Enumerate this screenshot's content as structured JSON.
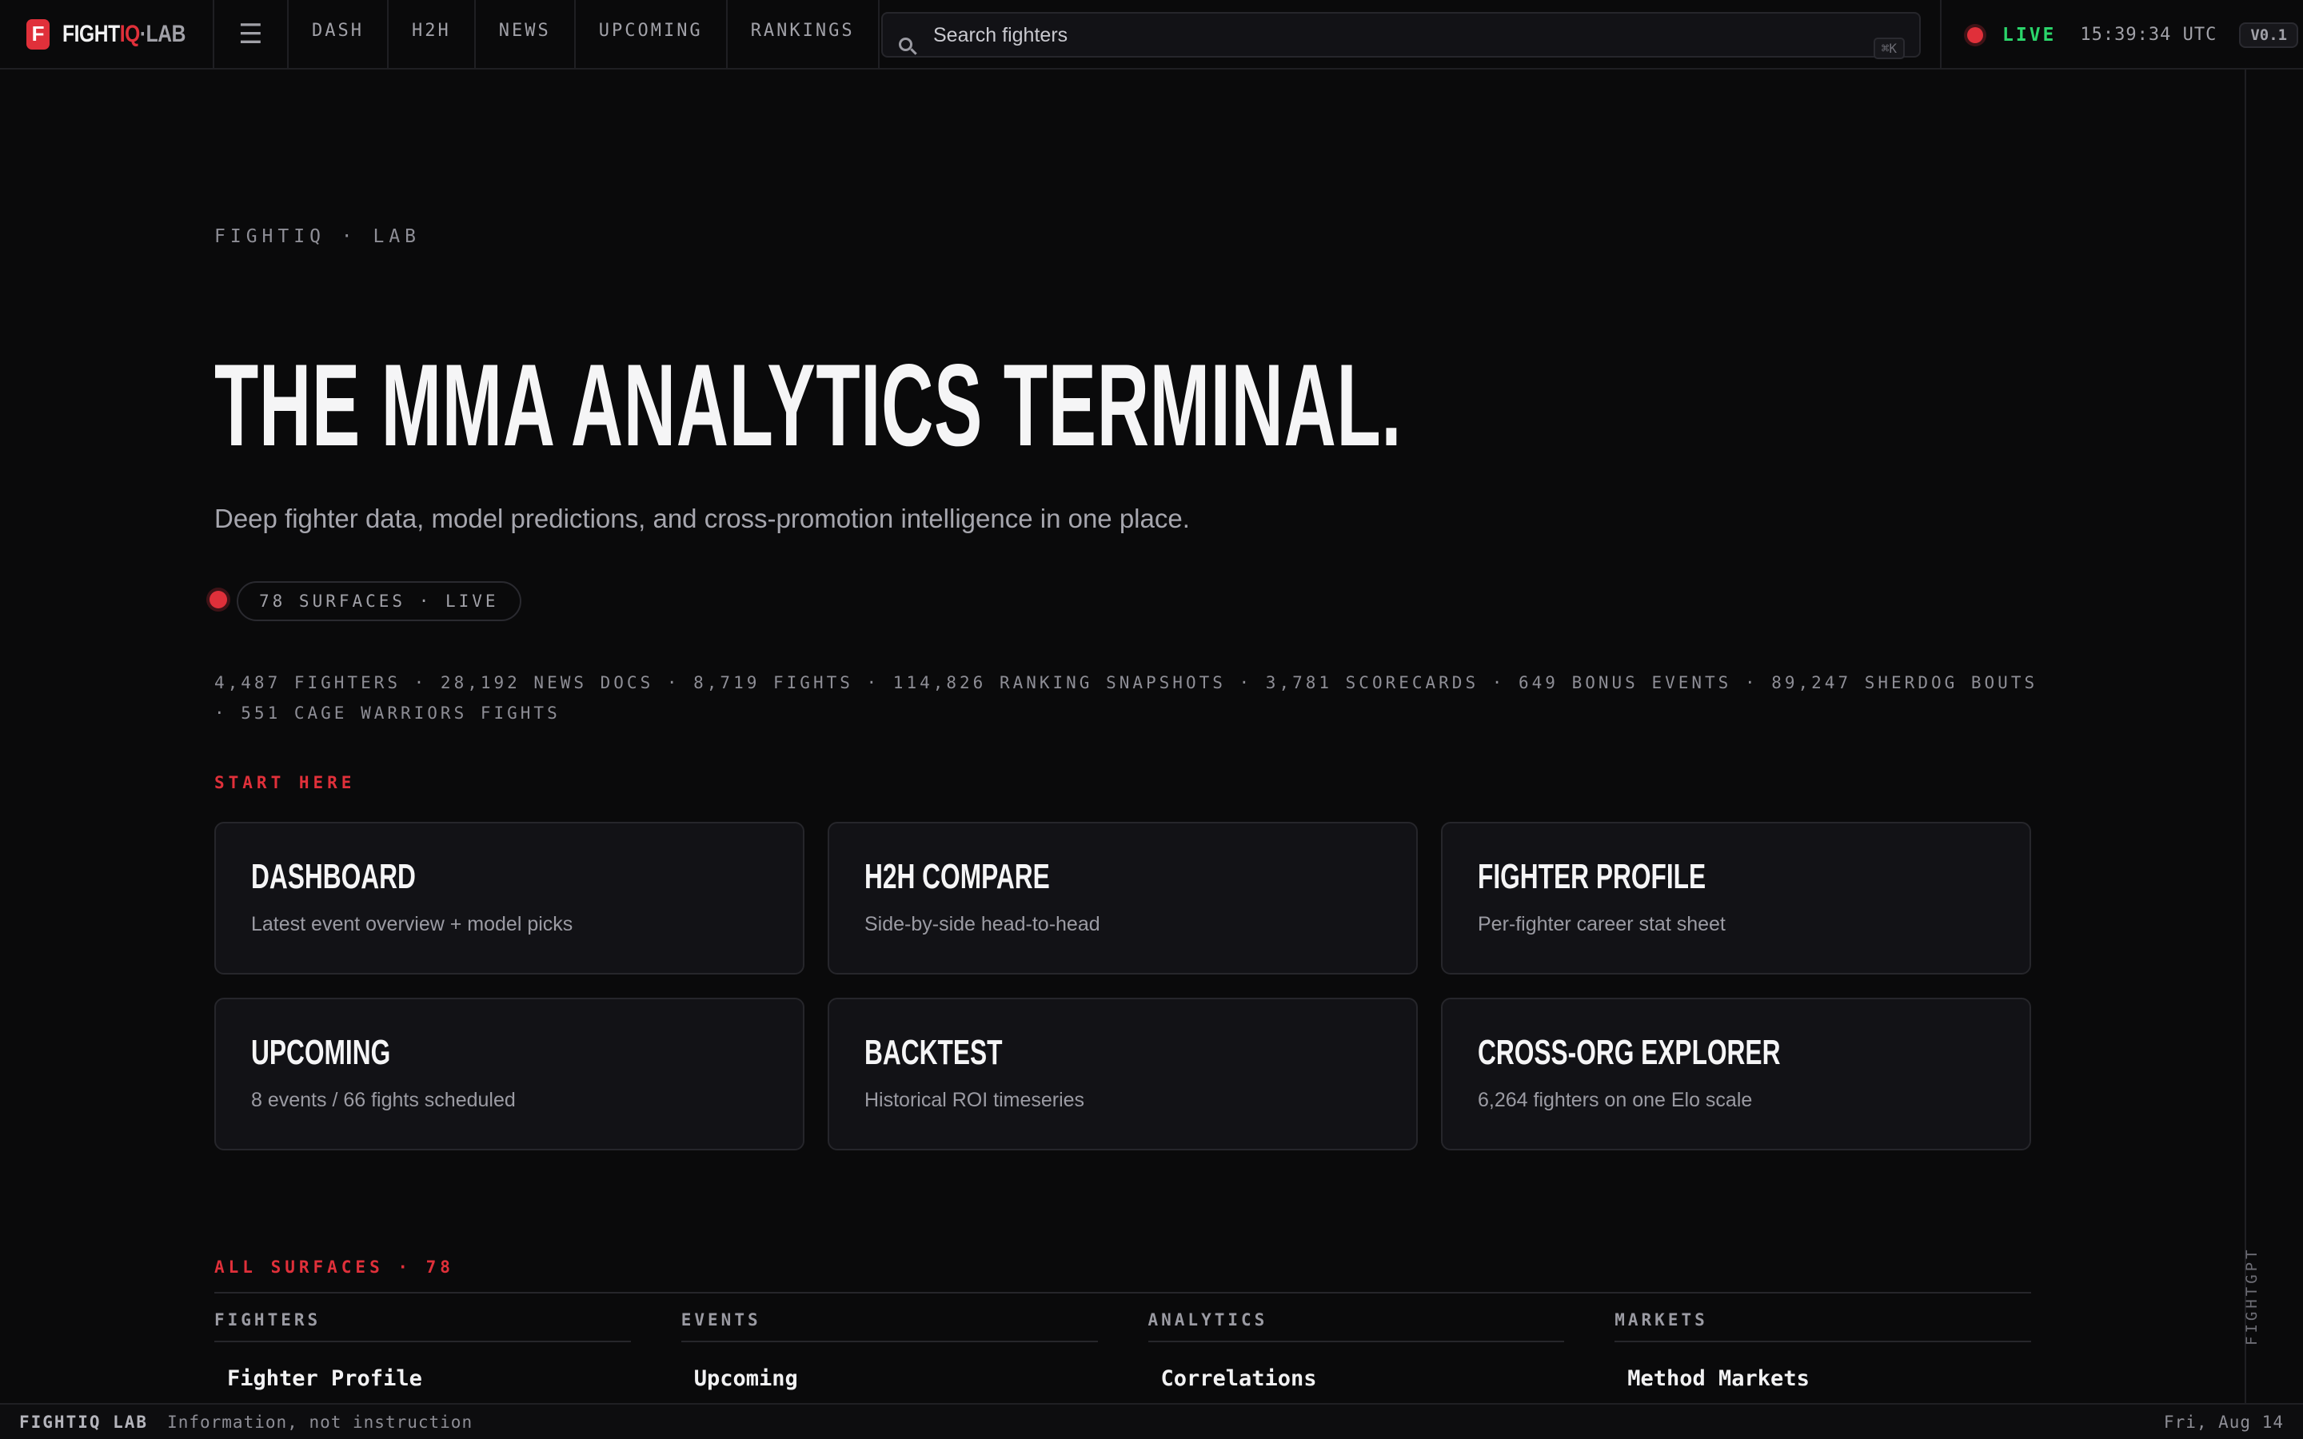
{
  "brand": {
    "badge": "F",
    "name_part1": "FIGHT",
    "name_part2": "IQ",
    "name_part3": "·LAB"
  },
  "nav": {
    "menu_icon": "hamburger-icon",
    "items": [
      {
        "label": "DASH"
      },
      {
        "label": "H2H"
      },
      {
        "label": "NEWS"
      },
      {
        "label": "UPCOMING"
      },
      {
        "label": "RANKINGS"
      }
    ]
  },
  "search": {
    "placeholder": "Search fighters",
    "value": "",
    "shortcut": "⌘K",
    "icon": "search-icon"
  },
  "status": {
    "live_label": "LIVE",
    "time": "15:39:34 UTC",
    "version": "V0.1"
  },
  "rail": {
    "label": "FIGHTGPT"
  },
  "hero": {
    "eyebrow": "FIGHTIQ · LAB",
    "title": "THE MMA ANALYTICS TERMINAL.",
    "subtitle": "Deep fighter data, model predictions, and cross-promotion intelligence in one place.",
    "surfaces_pill": "78 SURFACES · LIVE",
    "stats_line": "4,487 FIGHTERS  ·  28,192 NEWS DOCS  ·  8,719 FIGHTS  ·  114,826 RANKING SNAPSHOTS  ·  3,781 SCORECARDS  ·  649 BONUS EVENTS  ·  89,247 SHERDOG BOUTS  ·  551 CAGE WARRIORS FIGHTS"
  },
  "start_here": {
    "label": "START HERE",
    "cards": [
      {
        "title": "DASHBOARD",
        "desc": "Latest event overview + model picks"
      },
      {
        "title": "H2H COMPARE",
        "desc": "Side-by-side head-to-head"
      },
      {
        "title": "FIGHTER PROFILE",
        "desc": "Per-fighter career stat sheet"
      },
      {
        "title": "UPCOMING",
        "desc": "8 events / 66 fights scheduled"
      },
      {
        "title": "BACKTEST",
        "desc": "Historical ROI timeseries"
      },
      {
        "title": "CROSS-ORG EXPLORER",
        "desc": "6,264 fighters on one Elo scale"
      }
    ]
  },
  "all_surfaces": {
    "label": "ALL SURFACES · 78",
    "columns": [
      {
        "heading": "FIGHTERS",
        "first_item": "Fighter Profile"
      },
      {
        "heading": "EVENTS",
        "first_item": "Upcoming"
      },
      {
        "heading": "ANALYTICS",
        "first_item": "Correlations"
      },
      {
        "heading": "MARKETS",
        "first_item": "Method Markets"
      }
    ]
  },
  "footer": {
    "brand": "FIGHTIQ LAB",
    "note": "Information, not instruction",
    "date": "Fri, Aug 14"
  },
  "colors": {
    "accent": "#e0303a",
    "live": "#2bd56b",
    "background": "#0a0a0b",
    "card": "#121216"
  }
}
